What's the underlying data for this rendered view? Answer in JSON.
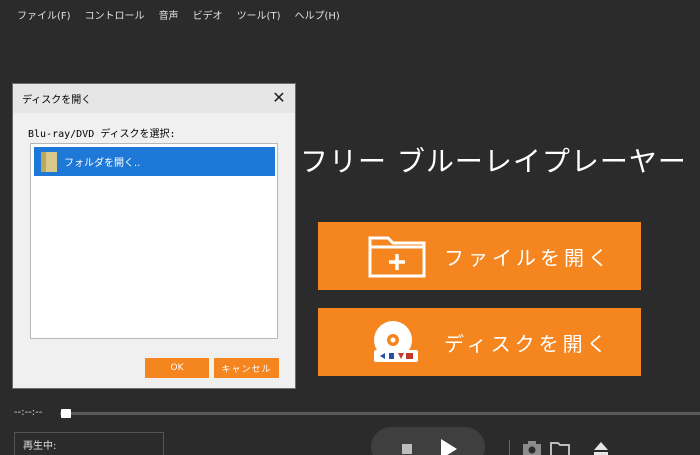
{
  "menu": [
    "ファイル(F)",
    "コントロール",
    "音声",
    "ビデオ",
    "ツール(T)",
    "ヘルプ(H)"
  ],
  "main": {
    "title": "フリー ブルーレイプレーヤー",
    "open_file_label": "ファイルを開く",
    "open_disc_label": "ディスクを開く",
    "accent_color": "#f4851f"
  },
  "playback": {
    "time": "--:--:--",
    "status_label": "再生中:"
  },
  "dialog": {
    "title": "ディスクを開く",
    "prompt": "Blu-ray/DVD ディスクを選択:",
    "items": [
      {
        "label": "フォルダを開く..",
        "icon": "folder-icon",
        "selected": true
      }
    ],
    "ok_label": "OK",
    "cancel_label": "キャンセル",
    "selection_color": "#1e78d7"
  },
  "icons": {
    "open_file": "folder-add-icon",
    "open_disc": "disc-icon",
    "stop": "stop-icon",
    "play": "play-icon",
    "snapshot": "camera-icon",
    "folder": "folder-icon",
    "eject": "eject-icon",
    "close": "close-icon"
  }
}
